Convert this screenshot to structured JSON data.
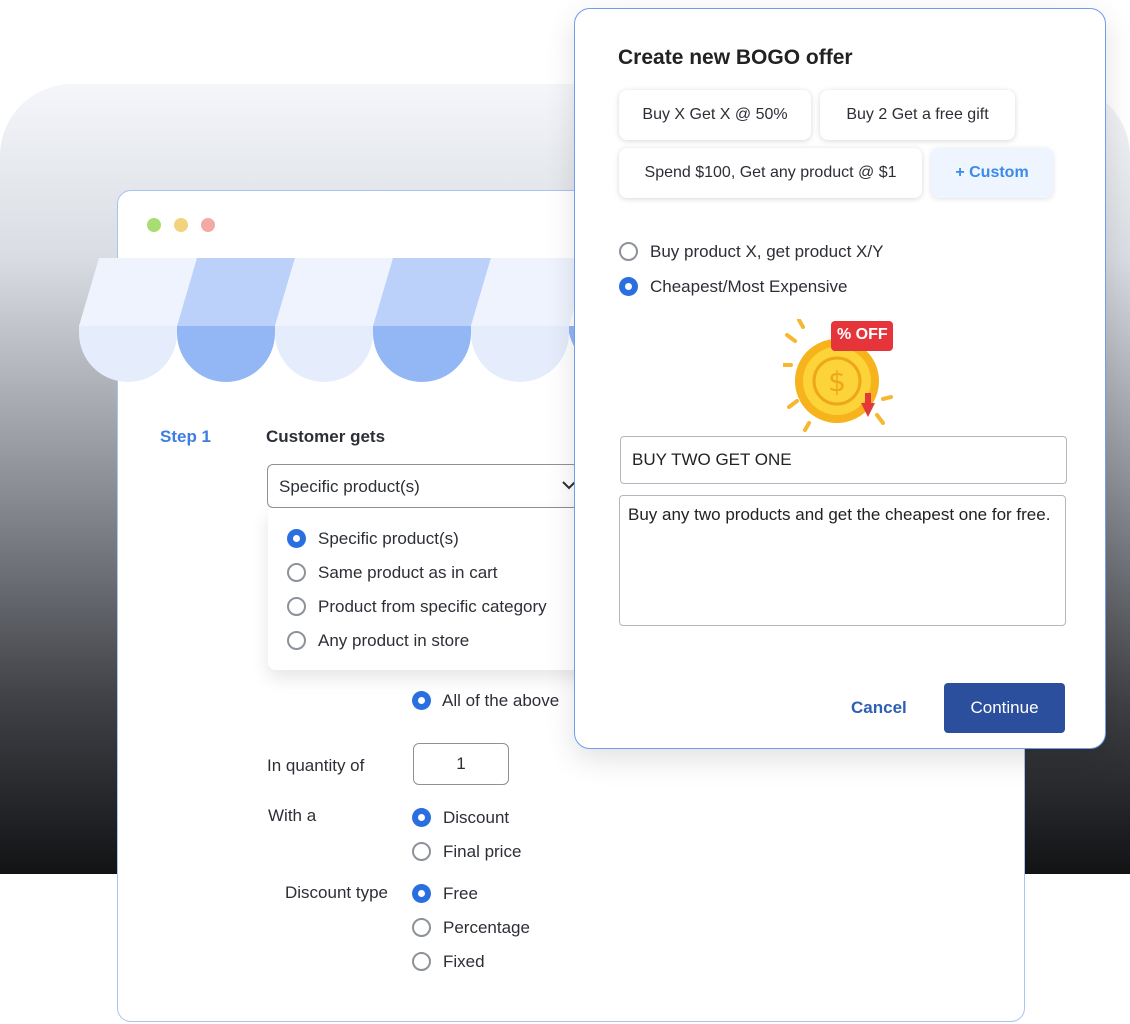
{
  "store": {
    "step_label": "Step 1",
    "customer_gets_label": "Customer gets",
    "select_value": "Specific product(s)",
    "dropdown_options": [
      {
        "label": "Specific product(s)",
        "selected": true
      },
      {
        "label": "Same product as in cart",
        "selected": false
      },
      {
        "label": "Product from specific category",
        "selected": false
      },
      {
        "label": "Any product in store",
        "selected": false
      }
    ],
    "all_of_above": "All of the above",
    "quantity_label": "In quantity of",
    "quantity_value": "1",
    "with_a_label": "With a",
    "with_a_options": [
      {
        "label": "Discount",
        "selected": true
      },
      {
        "label": "Final price",
        "selected": false
      }
    ],
    "discount_type_label": "Discount type",
    "discount_type_options": [
      {
        "label": "Free",
        "selected": true
      },
      {
        "label": "Percentage",
        "selected": false
      },
      {
        "label": "Fixed",
        "selected": false
      }
    ]
  },
  "modal": {
    "title": "Create new BOGO offer",
    "chips": [
      "Buy X Get X @ 50%",
      "Buy 2 Get a free gift",
      "Spend $100, Get any product @ $1",
      "+ Custom"
    ],
    "offer_types": [
      {
        "label": "Buy product X, get product X/Y",
        "selected": false
      },
      {
        "label": "Cheapest/Most Expensive",
        "selected": true
      }
    ],
    "badge_text": "% OFF",
    "offer_title_value": "BUY TWO GET ONE",
    "offer_description_value": "Buy any two products and get the cheapest one for free.",
    "cancel_label": "Cancel",
    "continue_label": "Continue"
  },
  "colors": {
    "accent": "#2a6fe0",
    "primary_button": "#2c4f9d",
    "link": "#2e5fb2",
    "custom_chip": "#3a8be8"
  }
}
